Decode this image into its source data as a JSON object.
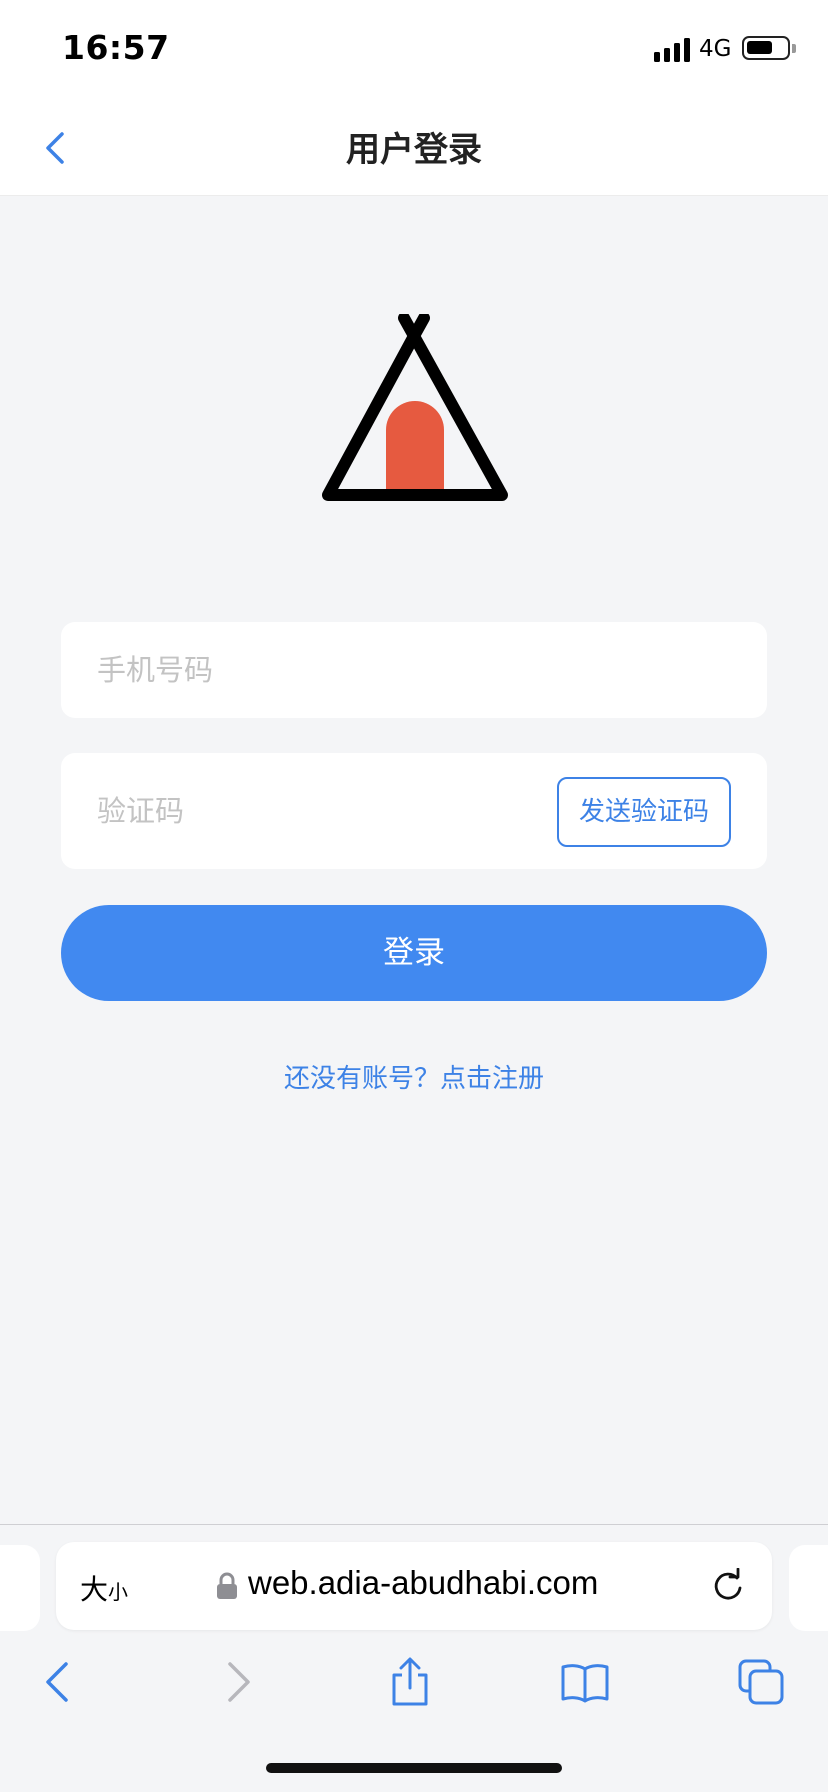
{
  "status_bar": {
    "time": "16:57",
    "network": "4G",
    "battery_level": 0.6
  },
  "nav": {
    "back_icon": "chevron-left-icon",
    "title": "用户登录"
  },
  "logo": {
    "icon": "tent-logo-icon",
    "colors": {
      "outline": "#000000",
      "door": "#e65a40"
    }
  },
  "form": {
    "phone_placeholder": "手机号码",
    "code_placeholder": "验证码",
    "send_code_label": "发送验证码",
    "login_label": "登录",
    "register_link": "还没有账号？点击注册"
  },
  "browser": {
    "text_size_big": "大",
    "text_size_small": "小",
    "url": "web.adia-abudhabi.com",
    "toolbar_icons": [
      "back-icon",
      "forward-icon",
      "share-icon",
      "bookmarks-icon",
      "tabs-icon"
    ]
  },
  "colors": {
    "accent": "#4189f0",
    "link": "#3d82e6",
    "background": "#f4f5f7"
  }
}
